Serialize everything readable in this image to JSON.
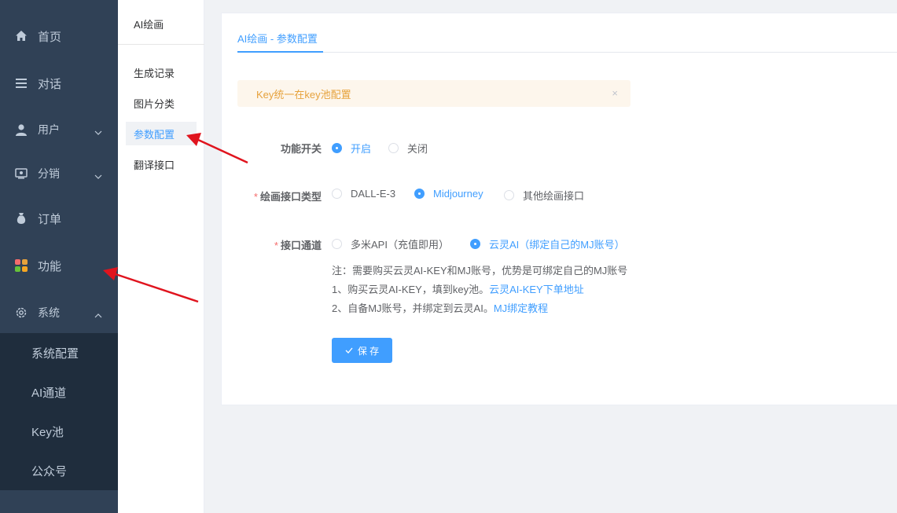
{
  "sidebar": {
    "items": [
      {
        "label": "首页",
        "icon": "home-icon"
      },
      {
        "label": "对话",
        "icon": "list-icon"
      },
      {
        "label": "用户",
        "icon": "user-icon"
      },
      {
        "label": "分销",
        "icon": "share-icon"
      },
      {
        "label": "订单",
        "icon": "money-bag-icon"
      },
      {
        "label": "功能",
        "icon": "apps-icon"
      },
      {
        "label": "系统",
        "icon": "gear-icon"
      }
    ],
    "submenu": [
      "系统配置",
      "AI通道",
      "Key池",
      "公众号"
    ]
  },
  "panel2": {
    "title": "AI绘画",
    "items": [
      "生成记录",
      "图片分类",
      "参数配置",
      "翻译接口"
    ]
  },
  "main": {
    "tab": "AI绘画 - 参数配置",
    "alert": "Key统一在key池配置",
    "alert_close": "×",
    "form": {
      "switch_label": "功能开关",
      "switch_options": [
        "开启",
        "关闭"
      ],
      "type_label": "绘画接口类型",
      "type_options": [
        "DALL-E-3",
        "Midjourney",
        "其他绘画接口"
      ],
      "channel_label": "接口通道",
      "channel_options": [
        "多米API（充值即用）",
        "云灵AI（绑定自己的MJ账号）"
      ],
      "required_mark": "*"
    },
    "notes": {
      "line1": "注：需要购买云灵AI-KEY和MJ账号，优势是可绑定自己的MJ账号",
      "line2_text": "1、购买云灵AI-KEY，填到key池。",
      "line2_link": "云灵AI-KEY下单地址",
      "line3_text": "2、自备MJ账号，并绑定到云灵AI。",
      "line3_link": "MJ绑定教程"
    },
    "save_label": "保 存"
  },
  "colors": {
    "sidebar_bg": "#304156",
    "submenu_bg": "#1f2d3d",
    "primary": "#409eff",
    "warning_text": "#e6a23c",
    "warning_bg": "#fdf6ec",
    "arrow": "#e0141e"
  }
}
